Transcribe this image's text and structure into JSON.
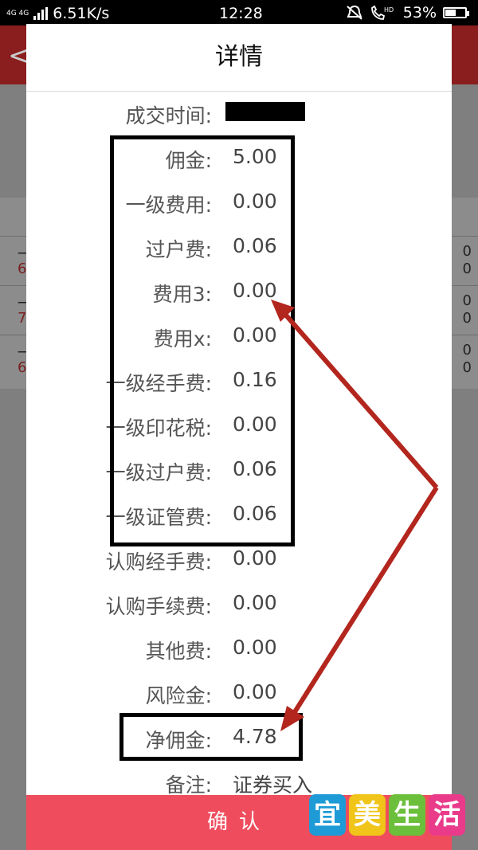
{
  "status_bar": {
    "network": "4G 4G",
    "speed": "6.51K/s",
    "time": "12:28",
    "hd": "HD",
    "battery": "53%",
    "battery_level": 0.53
  },
  "background": {
    "rows": [
      {
        "l1": "一",
        "l2": "6",
        "r1": "0",
        "r2": "0"
      },
      {
        "l1": "一",
        "l2": "7",
        "r1": "0",
        "r2": "0"
      },
      {
        "l1": "一",
        "l2": "6",
        "r1": "0",
        "r2": "0"
      }
    ]
  },
  "dialog": {
    "title": "详情",
    "trade_time_label": "成交时间:",
    "rows": [
      {
        "label": "佣金:",
        "value": "5.00"
      },
      {
        "label": "一级费用:",
        "value": "0.00"
      },
      {
        "label": "过户费:",
        "value": "0.06"
      },
      {
        "label": "费用3:",
        "value": "0.00"
      },
      {
        "label": "费用x:",
        "value": "0.00"
      },
      {
        "label": "一级经手费:",
        "value": "0.16"
      },
      {
        "label": "一级印花税:",
        "value": "0.00"
      },
      {
        "label": "一级过户费:",
        "value": "0.06"
      },
      {
        "label": "一级证管费:",
        "value": "0.06"
      },
      {
        "label": "认购经手费:",
        "value": "0.00"
      },
      {
        "label": "认购手续费:",
        "value": "0.00"
      },
      {
        "label": "其他费:",
        "value": "0.00"
      },
      {
        "label": "风险金:",
        "value": "0.00"
      },
      {
        "label": "净佣金:",
        "value": "4.78"
      },
      {
        "label": "备注:",
        "value": "证券买入"
      }
    ],
    "confirm_label": "确认"
  },
  "watermark": {
    "chars": [
      "宜",
      "美",
      "生",
      "活"
    ],
    "colors": [
      "#1e9ad6",
      "#f0c419",
      "#6cbf3a",
      "#e93b8a"
    ]
  },
  "colors": {
    "confirm_bg": "#ef4d5d",
    "annotation_arrow": "#b3261e",
    "annotation_box": "#000000"
  }
}
